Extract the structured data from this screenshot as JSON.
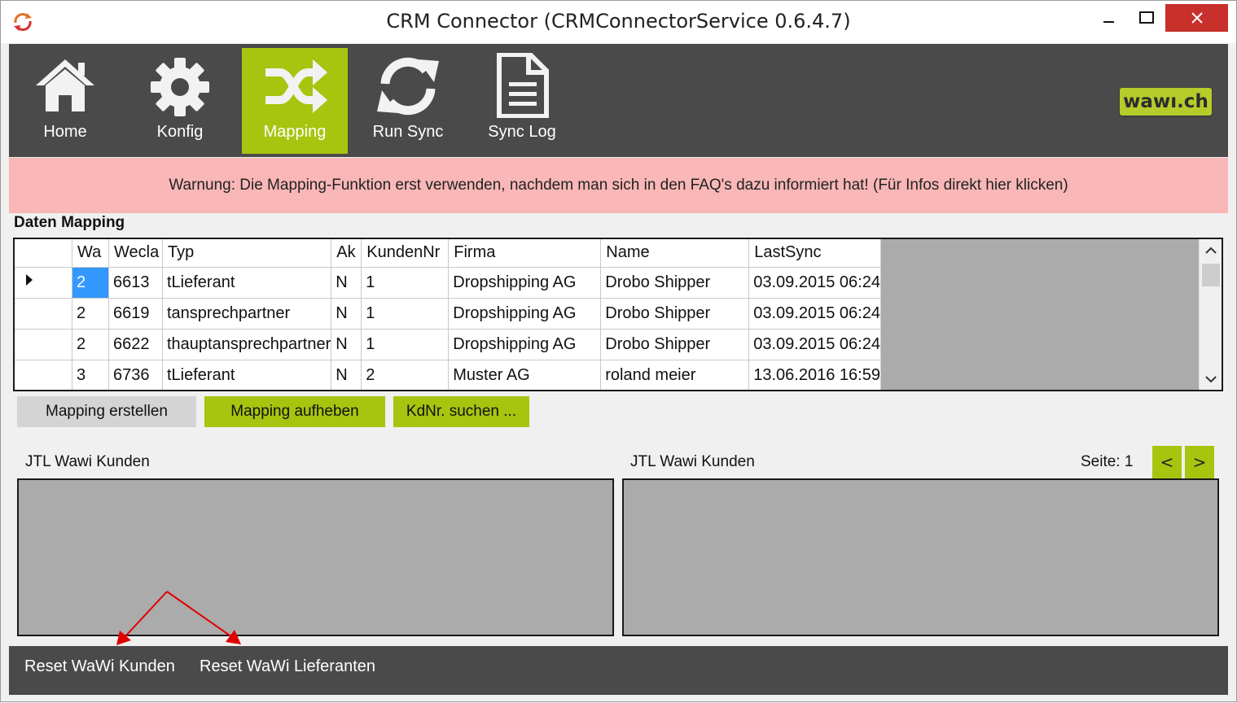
{
  "window": {
    "title": "CRM Connector (CRMConnectorService 0.6.4.7)"
  },
  "nav": {
    "items": [
      {
        "label": "Home",
        "icon": "home-icon"
      },
      {
        "label": "Konfig",
        "icon": "gear-icon"
      },
      {
        "label": "Mapping",
        "icon": "shuffle-icon",
        "active": true
      },
      {
        "label": "Run Sync",
        "icon": "sync-icon"
      },
      {
        "label": "Sync Log",
        "icon": "document-icon"
      }
    ],
    "logo_text": "wawı.ch"
  },
  "warning": {
    "text": "Warnung: Die Mapping-Funktion erst verwenden, nachdem man sich in den FAQ's dazu informiert hat! (Für Infos direkt hier klicken)"
  },
  "mapping": {
    "title": "Daten Mapping",
    "columns": [
      "Wa",
      "Wecla",
      "Typ",
      "Ak",
      "KundenNr",
      "Firma",
      "Name",
      "LastSync"
    ],
    "rows": [
      [
        "2",
        "6613",
        "tLieferant",
        "N",
        "1",
        "Dropshipping AG",
        "Drobo Shipper",
        "03.09.2015 06:24"
      ],
      [
        "2",
        "6619",
        "tansprechpartner",
        "N",
        "1",
        "Dropshipping AG",
        "Drobo Shipper",
        "03.09.2015 06:24"
      ],
      [
        "2",
        "6622",
        "thauptansprechpartner",
        "N",
        "1",
        "Dropshipping AG",
        "Drobo Shipper",
        "03.09.2015 06:24"
      ],
      [
        "3",
        "6736",
        "tLieferant",
        "N",
        "2",
        "Muster AG",
        "roland meier",
        "13.06.2016 16:59"
      ]
    ]
  },
  "actions": {
    "create": "Mapping erstellen",
    "remove": "Mapping aufheben",
    "search": "KdNr. suchen ..."
  },
  "panels": {
    "left_label": "JTL Wawi Kunden",
    "right_label": "JTL Wawi Kunden",
    "page_label": "Seite: 1",
    "prev": "<",
    "next": ">"
  },
  "footer": {
    "reset_customers": "Reset WaWi Kunden",
    "reset_suppliers": "Reset WaWi Lieferanten"
  },
  "colors": {
    "accent": "#a7c40f",
    "toolbar": "#4a4a4a",
    "warning_bg": "#f9b7b7",
    "annotation_arrow": "#e00000"
  }
}
